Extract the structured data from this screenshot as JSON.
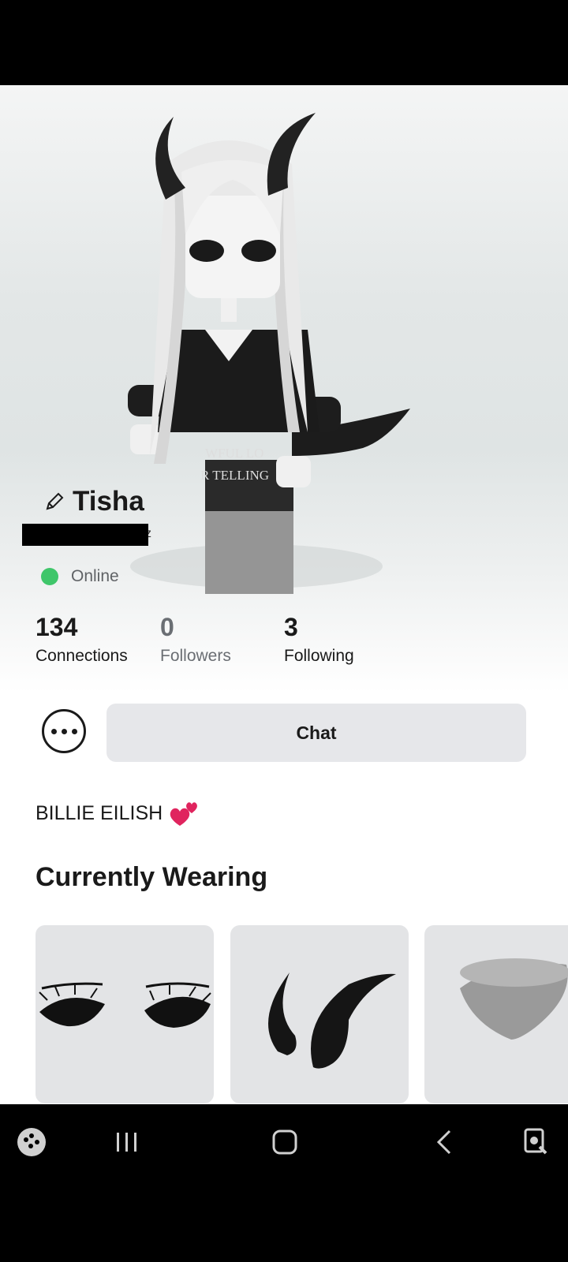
{
  "profile": {
    "display_name": "Tisha",
    "username_visible": "zzz",
    "status": "Online",
    "bio_text": "BILLIE EILISH",
    "shirt_text_line1": "WFUL LO",
    "shirt_text_line2": "R TELLING"
  },
  "stats": [
    {
      "value": "134",
      "label": "Connections"
    },
    {
      "value": "0",
      "label": "Followers"
    },
    {
      "value": "3",
      "label": "Following"
    }
  ],
  "actions": {
    "chat_label": "Chat"
  },
  "wearing": {
    "title": "Currently Wearing",
    "items": [
      {
        "icon": "eyelashes-face-icon"
      },
      {
        "icon": "horns-icon"
      },
      {
        "icon": "torso-part-icon"
      }
    ]
  },
  "colors": {
    "online": "#3fc66a",
    "heart": "#e0245e",
    "card_bg": "#e3e4e6"
  }
}
